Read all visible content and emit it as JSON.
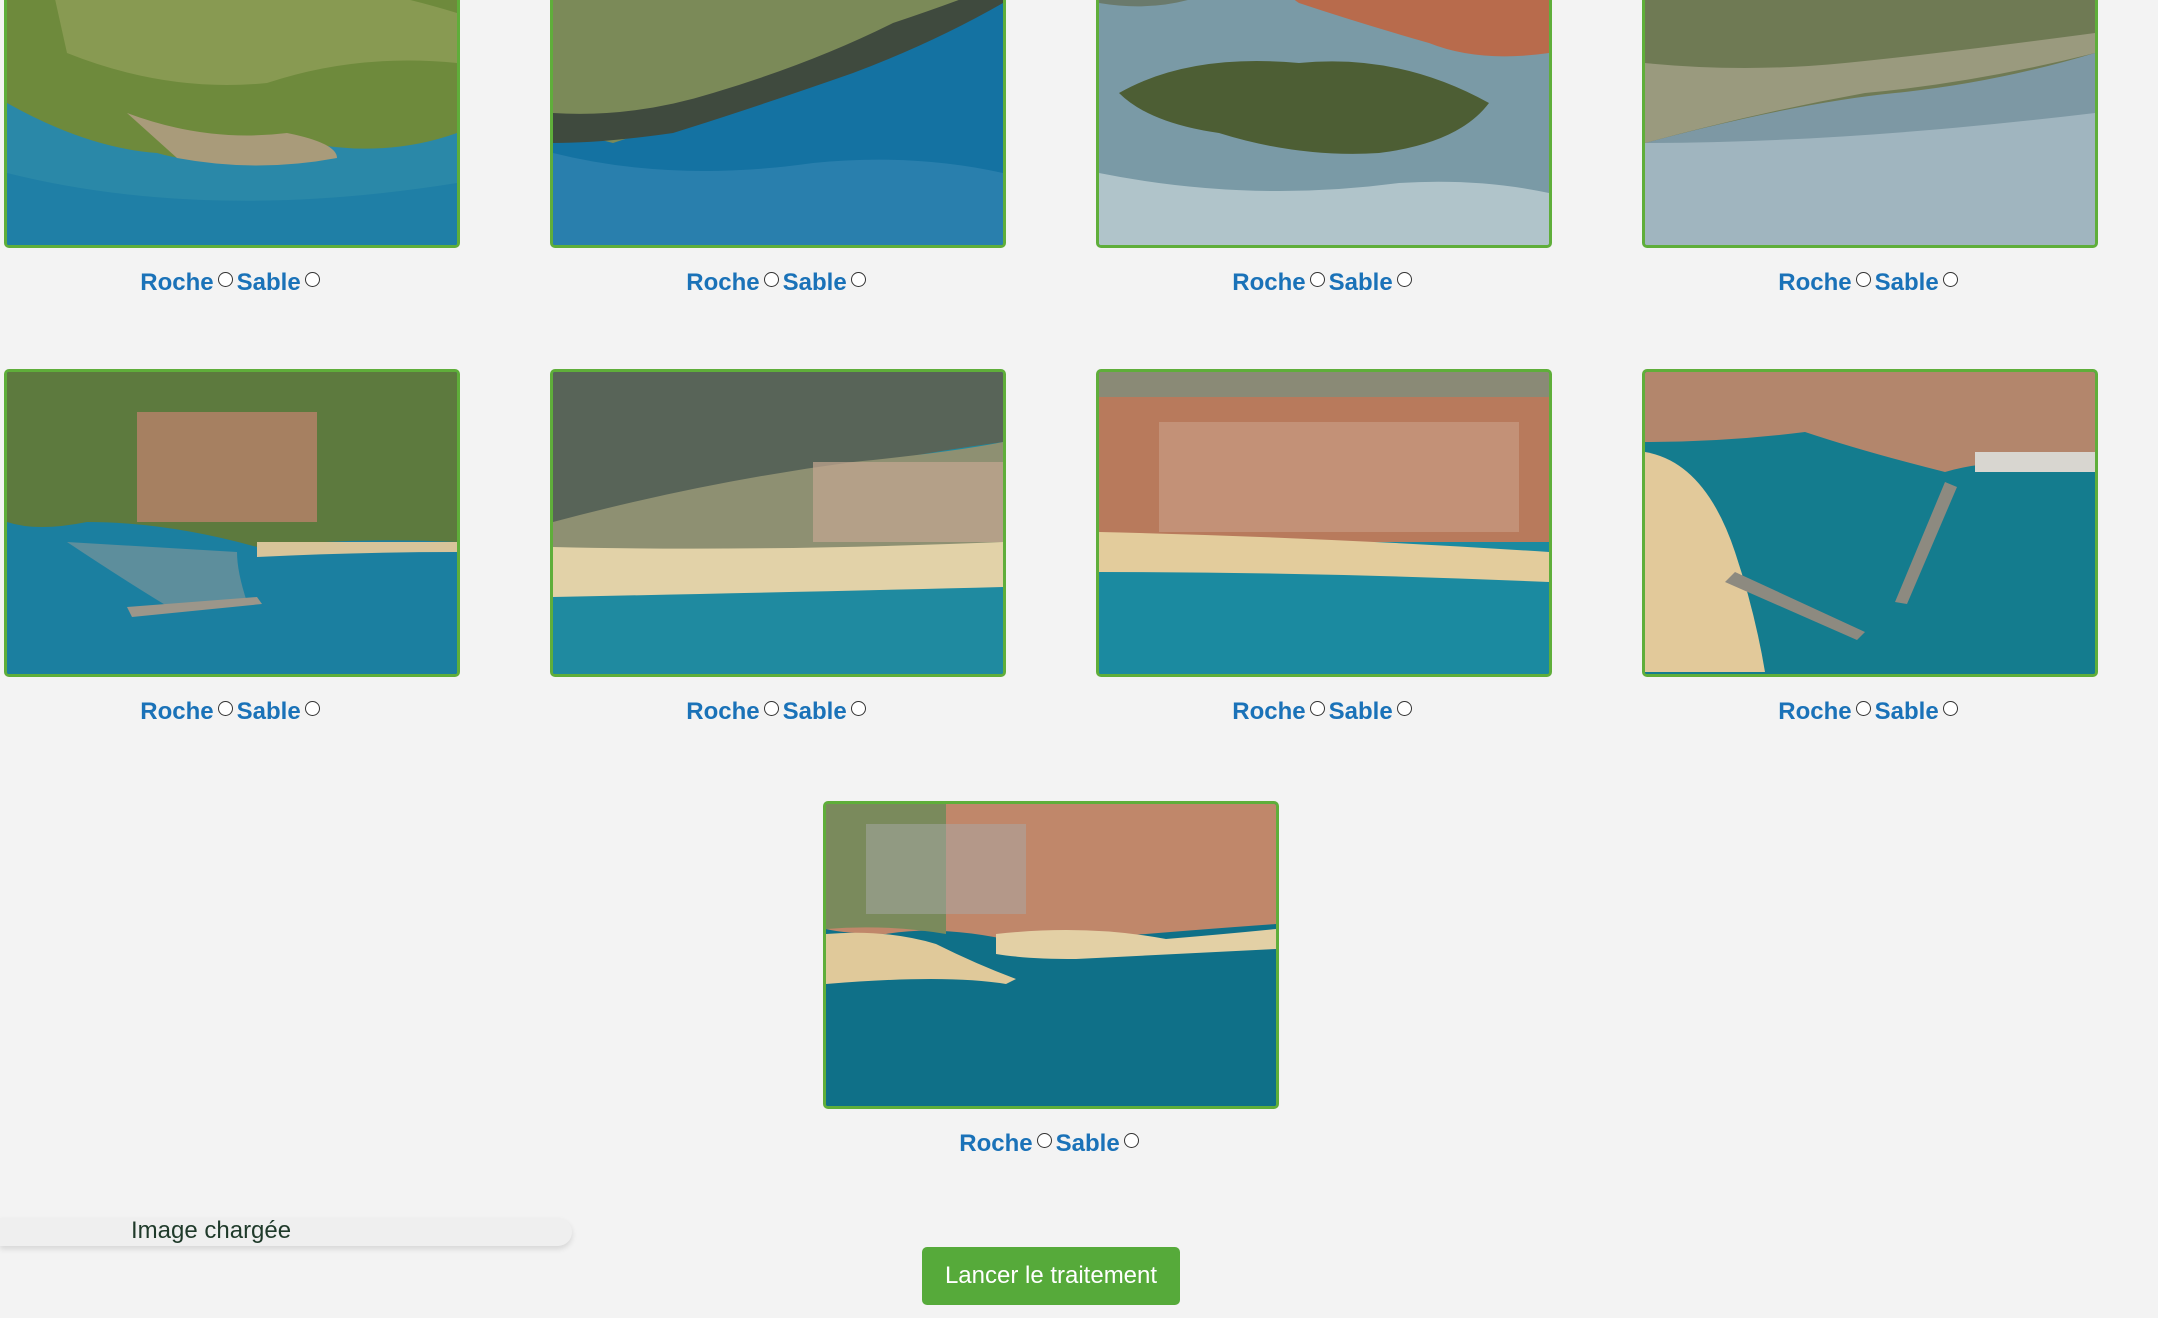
{
  "cards": [
    {
      "roche_label": "Roche",
      "sable_label": "Sable",
      "image": "aerial-coast-cliffs-vegetation"
    },
    {
      "roche_label": "Roche",
      "sable_label": "Sable",
      "image": "aerial-rocky-headland"
    },
    {
      "roche_label": "Roche",
      "sable_label": "Sable",
      "image": "aerial-harbour-town-peninsula"
    },
    {
      "roche_label": "Roche",
      "sable_label": "Sable",
      "image": "aerial-coastline-town-vineyards"
    },
    {
      "roche_label": "Roche",
      "sable_label": "Sable",
      "image": "aerial-marina-town"
    },
    {
      "roche_label": "Roche",
      "sable_label": "Sable",
      "image": "aerial-beach-resort-lagoon"
    },
    {
      "roche_label": "Roche",
      "sable_label": "Sable",
      "image": "aerial-beach-town"
    },
    {
      "roche_label": "Roche",
      "sable_label": "Sable",
      "image": "aerial-port-jetties"
    },
    {
      "roche_label": "Roche",
      "sable_label": "Sable",
      "image": "aerial-marina-breakwaters"
    }
  ],
  "status": {
    "text": "Image chargée"
  },
  "actions": {
    "launch_label": "Lancer le traitement"
  },
  "colors": {
    "background": "#f3f3f3",
    "card_border": "#5fae3a",
    "label_blue": "#1a72b8",
    "button_green": "#56aa3a"
  }
}
